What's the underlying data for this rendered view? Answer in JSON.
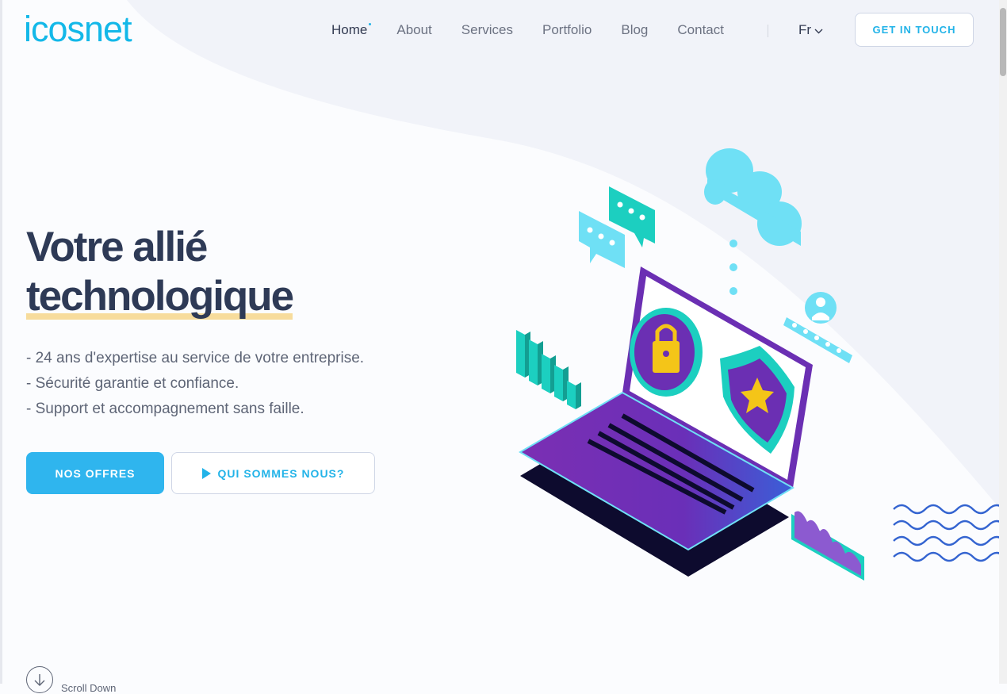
{
  "brand": {
    "logo_text": "icosnet",
    "color": "#13b8e8"
  },
  "nav": {
    "items": [
      {
        "label": "Home",
        "active": true
      },
      {
        "label": "About"
      },
      {
        "label": "Services"
      },
      {
        "label": "Portfolio"
      },
      {
        "label": "Blog"
      },
      {
        "label": "Contact"
      }
    ],
    "language": "Fr",
    "cta_label": "GET IN TOUCH"
  },
  "hero": {
    "title_line1": "Votre allié",
    "title_line2": "technologique",
    "points": [
      "- 24 ans d'expertise au service de votre entreprise.",
      "- Sécurité garantie et confiance.",
      "- Support et accompagnement sans faille."
    ],
    "primary_button": "NOS OFFRES",
    "secondary_button": "QUI SOMMES NOUS?",
    "scroll_label": "Scroll Down"
  },
  "colors": {
    "accent": "#2fb5ee",
    "title": "#2e3a56",
    "highlight": "#f7dc9c",
    "purple": "#6b2fb3",
    "teal": "#1ccfc0"
  },
  "icons": {
    "chevron": "chevron-down-icon",
    "play": "play-icon",
    "scroll": "arrow-down-icon"
  }
}
